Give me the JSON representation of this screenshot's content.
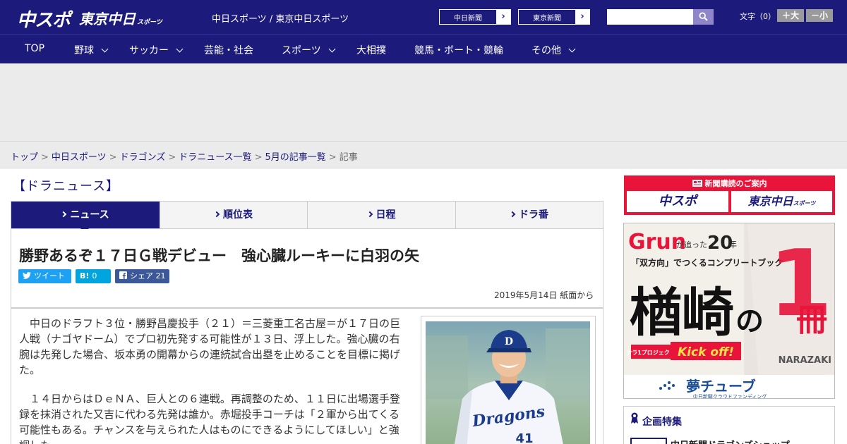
{
  "header": {
    "logo_chuspo": "中スポ",
    "logo_tokyo": "東京中日",
    "logo_tokyo_sub": "スポーツ",
    "caption": "中日スポーツ / 東京中日スポーツ",
    "btn_chunichi": "中日新聞",
    "btn_tokyo": "東京新聞",
    "arrow": "›",
    "search_placeholder": "",
    "font_label": "文字（0）",
    "font_plus": "＋大",
    "font_minus": "－小"
  },
  "nav": {
    "items": [
      "TOP",
      "野球",
      "サッカー",
      "芸能・社会",
      "スポーツ",
      "大相撲",
      "競馬・ボート・競輪",
      "その他"
    ]
  },
  "breadcrumb": {
    "items": [
      "トップ",
      "中日スポーツ",
      "ドラゴンズ",
      "ドラニュース一覧",
      "5月の記事一覧"
    ],
    "current": "記事",
    "separator": ">"
  },
  "section_title": "【ドラニュース】",
  "tabs": [
    "ニュース",
    "順位表",
    "日程",
    "ドラ番"
  ],
  "article": {
    "headline": "勝野あるぞ１７日Ｇ戦デビュー　強心臓ルーキーに白羽の矢",
    "tweet": "ツイート",
    "hatena_icon": "B!",
    "hatena_count": "0",
    "share": "シェア",
    "share_count": "21",
    "date": "2019年5月14日 紙面から",
    "paragraphs": [
      "　中日のドラフト３位・勝野昌慶投手（２１）＝三菱重工名古屋＝が１７日の巨人戦（ナゴヤドーム）でプロ初先発する可能性が１３日、浮上した。強心臓の右腕は先発した場合、坂本勇の開幕からの連続試合出塁を止めることを目標に掲げた。",
      "　１４日からはＤｅＮＡ、巨人との６連戦。再調整のため、１１日に出場選手登録を抹消された又吉に代わる先発は誰か。赤堀投手コーチは「２軍から出てくる可能性もある。チャンスを与えられた人はものにできるようにしてほしい」と強調した。"
    ],
    "photo_team": "Dragons",
    "photo_number": "41",
    "photo_cap_letter": "D"
  },
  "sidebar": {
    "subscribe_title": "新聞購読のご案内",
    "sub_logo_1": "中スポ",
    "sub_logo_2": "東京中日",
    "sub_logo_2_small": "スポーツ",
    "banner": {
      "grun": "Grun",
      "grun_tail": "が追った",
      "years": "20",
      "years_unit": "年",
      "subtitle": "「双方向」でつくるコンプリートブック",
      "name": "楢崎",
      "no": "の",
      "one": "1",
      "book": "冊",
      "project": "ナラ1プロジェクト",
      "kickoff": "Kick off!",
      "player": "NARAZAKI",
      "yume": "夢チューブ",
      "yume_sub": "中日新聞クラウドファンディング"
    },
    "plan_title": "企画特集",
    "plan_item": "中日新聞ドラゴンズショップ"
  },
  "colors": {
    "brand_navy": "#1c1a7a",
    "accent_red": "#e8143a",
    "twitter": "#1da1f2",
    "hatena": "#00a4de",
    "facebook": "#3b5998"
  }
}
